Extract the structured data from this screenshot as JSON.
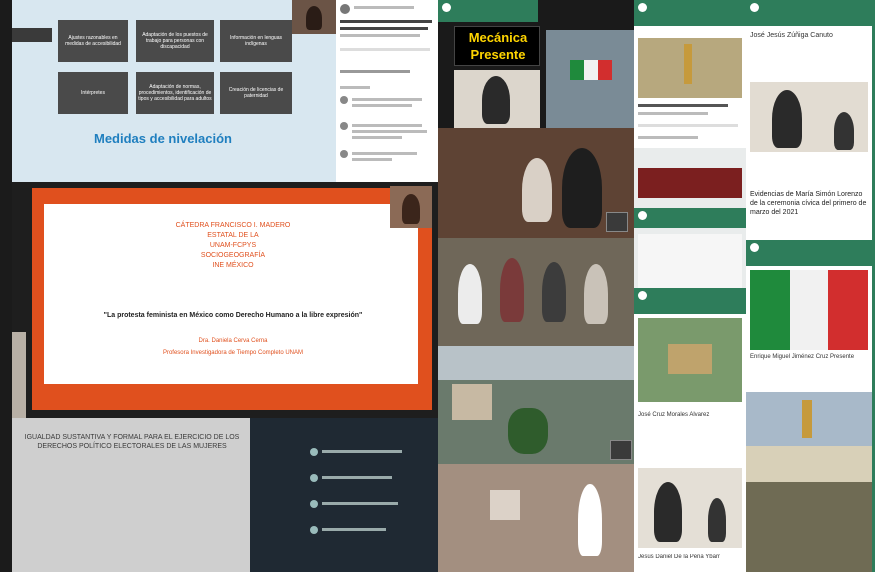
{
  "slide1": {
    "boxes": [
      "Ajustes razonables en medidas de accesibilidad",
      "Adaptación de los puestos de trabajo para personas con discapacidad",
      "Información en lenguas indígenas",
      "Intérpretes",
      "Adaptación de normas, procedimientos, identificación de tipos y accesibilidad para adultos",
      "Creación de licencias de paternidad"
    ],
    "title": "Medidas de nivelación"
  },
  "slide2": {
    "line1": "CÁTEDRA FRANCISCO I. MADERO",
    "line2": "ESTATAL DE LA",
    "line3": "UNAM-FCPYS",
    "line4": "SOCIOGEOGRAFÍA",
    "line5": "INE MÉXICO",
    "quote": "\"La protesta feminista en México como Derecho Humano a la libre expresión\"",
    "speaker": "Dra. Daniela Cerva Cerna",
    "role": "Profesora Investigadora de Tiempo Completo UNAM"
  },
  "slide3": {
    "text": "IGUALDAD SUSTANTIVA Y FORMAL PARA EL EJERCICIO DE LOS DERECHOS POLÍTICO ELECTORALES DE LAS MUJERES"
  },
  "mecanica": {
    "line1": "Mecánica",
    "line2": "Presente"
  },
  "right_panel": {
    "person_name": "José Jesús Zúñiga Canuto",
    "evidence": "Evidencias de María Simón Lorenzo de la ceremonia cívica del primero de marzo del 2021",
    "bottom_name": "Jesús Daniel De la Peña Ybarr",
    "mexico_caption": "Enrique Miguel Jiménez Cruz Presente",
    "bottom_caption": "José Cruz Morales Alvarez"
  },
  "colors": {
    "green_header": "#2e7d5b",
    "orange": "#e0501e",
    "slide_bg": "#d7e6ef",
    "blue_title": "#1f7fbf"
  }
}
